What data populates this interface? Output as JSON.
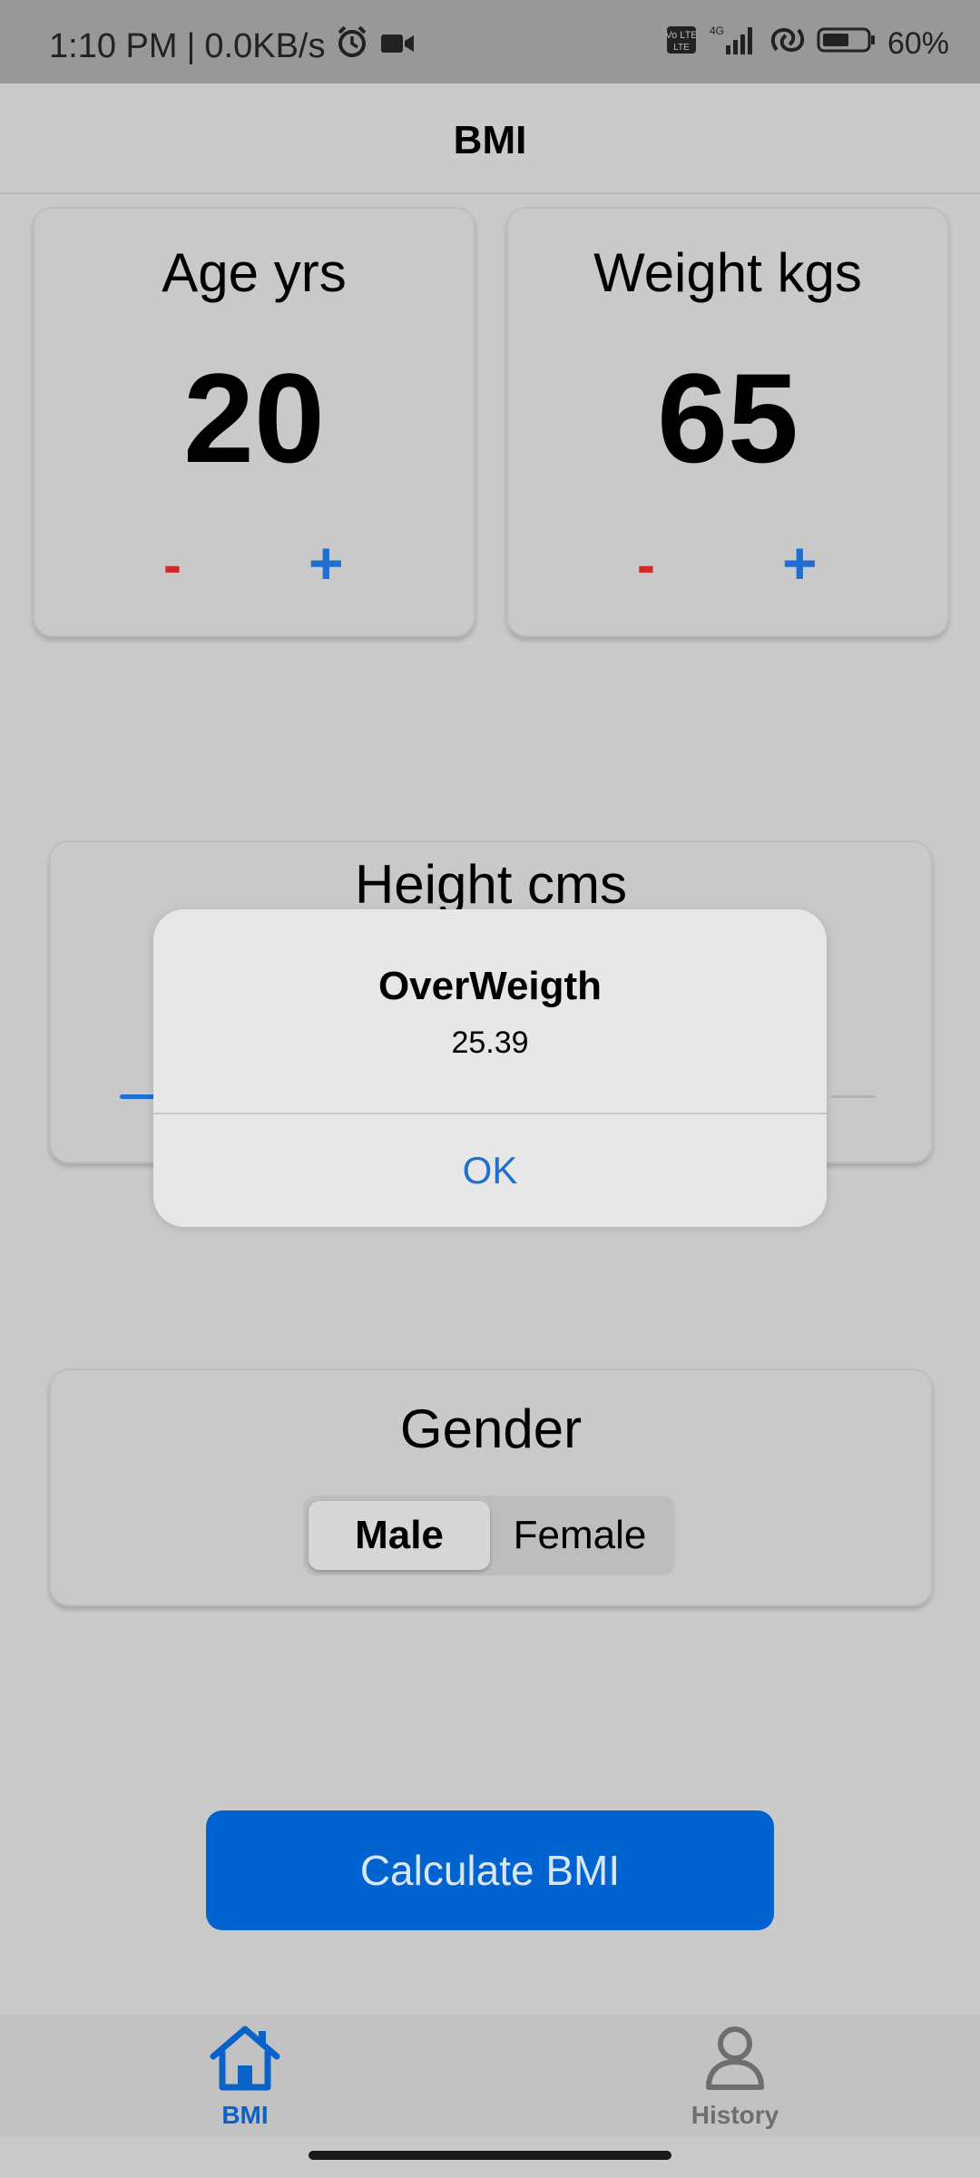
{
  "status_bar": {
    "time": "1:10 PM",
    "speed": "0.0KB/s",
    "network_badge": "Vo LTE",
    "network_type": "4G",
    "battery": "60%",
    "icons": [
      "alarm-icon",
      "video-icon",
      "volte-icon",
      "signal-icon",
      "hotspot-icon",
      "battery-icon"
    ]
  },
  "header": {
    "title": "BMI"
  },
  "age_card": {
    "label": "Age yrs",
    "value": "20",
    "minus": "-",
    "plus": "+"
  },
  "weight_card": {
    "label": "Weight kgs",
    "value": "65",
    "minus": "-",
    "plus": "+"
  },
  "height_card": {
    "label": "Height cms"
  },
  "gender_card": {
    "label": "Gender",
    "options": [
      "Male",
      "Female"
    ],
    "selected": "Male"
  },
  "calculate_button": {
    "label": "Calculate BMI"
  },
  "bottom_nav": {
    "items": [
      {
        "label": "BMI",
        "icon": "home-icon",
        "active": true
      },
      {
        "label": "History",
        "icon": "person-icon",
        "active": false
      }
    ]
  },
  "dialog": {
    "title": "OverWeigth",
    "message": "25.39",
    "ok_label": "OK"
  },
  "colors": {
    "accent": "#0063d0",
    "minus": "#d02a2a",
    "plus": "#1f6fd0"
  }
}
